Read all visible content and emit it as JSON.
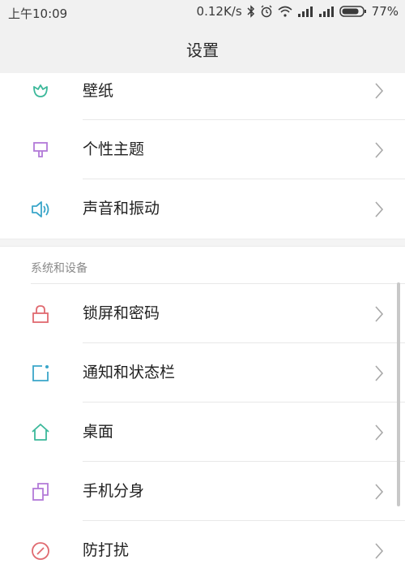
{
  "status_bar": {
    "time": "上午10:09",
    "network_speed": "0.12K/s",
    "battery": "77%",
    "icons": [
      "bluetooth-icon",
      "alarm-icon",
      "wifi-icon",
      "signal-icon",
      "signal-icon",
      "battery-icon"
    ]
  },
  "header": {
    "title": "设置"
  },
  "top_items": [
    {
      "label": "壁纸",
      "icon": "wallpaper-icon",
      "color": "#3bb89a"
    },
    {
      "label": "个性主题",
      "icon": "theme-brush-icon",
      "color": "#b27ad8"
    },
    {
      "label": "声音和振动",
      "icon": "speaker-icon",
      "color": "#3aa6c9"
    }
  ],
  "section": {
    "title": "系统和设备",
    "items": [
      {
        "label": "锁屏和密码",
        "icon": "lock-icon",
        "color": "#e06a70"
      },
      {
        "label": "通知和状态栏",
        "icon": "notification-icon",
        "color": "#3aa6c9"
      },
      {
        "label": "桌面",
        "icon": "home-icon",
        "color": "#3bb89a"
      },
      {
        "label": "手机分身",
        "icon": "dual-apps-icon",
        "color": "#b27ad8"
      },
      {
        "label": "防打扰",
        "icon": "do-not-disturb-icon",
        "color": "#e06a70"
      }
    ]
  }
}
